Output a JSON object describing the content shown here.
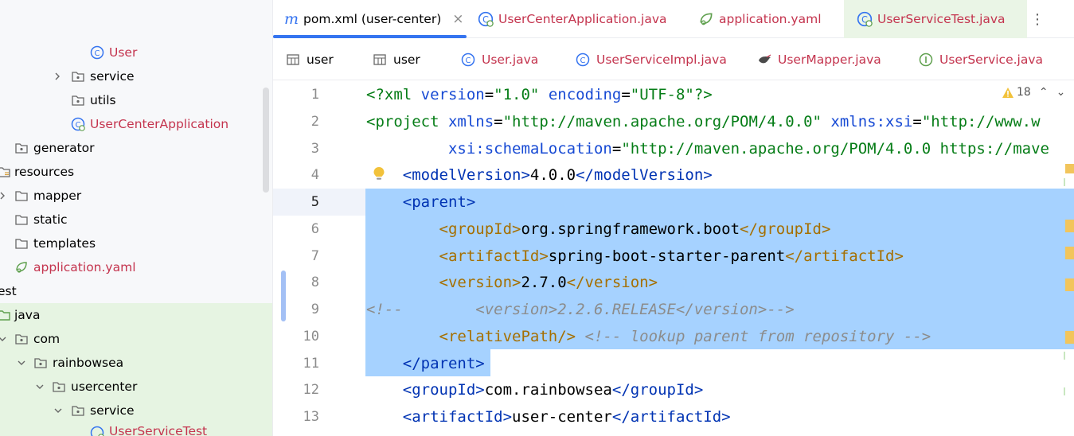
{
  "tree": {
    "items": [
      {
        "label": "User",
        "icon": "class-icon",
        "color": "red"
      },
      {
        "label": "service",
        "icon": "folder-icon",
        "chevron": "right"
      },
      {
        "label": "utils",
        "icon": "folder-icon"
      },
      {
        "label": "UserCenterApplication",
        "icon": "spring-class-icon",
        "color": "red"
      },
      {
        "label": "generator",
        "icon": "folder-icon"
      },
      {
        "label": "resources",
        "icon": "resources-folder-icon"
      },
      {
        "label": "mapper",
        "icon": "folder-icon",
        "chevron": "right"
      },
      {
        "label": "static",
        "icon": "folder-icon"
      },
      {
        "label": "templates",
        "icon": "folder-icon"
      },
      {
        "label": "application.yaml",
        "icon": "spring-leaf-icon",
        "color": "red"
      },
      {
        "label": "est",
        "icon": "none"
      },
      {
        "label": "java",
        "icon": "test-folder-icon"
      },
      {
        "label": "com",
        "icon": "folder-icon",
        "chevron": "down"
      },
      {
        "label": "rainbowsea",
        "icon": "folder-icon",
        "chevron": "down"
      },
      {
        "label": "usercenter",
        "icon": "folder-icon",
        "chevron": "down"
      },
      {
        "label": "service",
        "icon": "folder-icon",
        "chevron": "down"
      },
      {
        "label": "UserServiceTest",
        "icon": "spring-class-icon",
        "color": "red"
      }
    ]
  },
  "tabs": [
    {
      "label": "pom.xml (user-center)",
      "icon": "maven-icon",
      "active": true,
      "close": "×"
    },
    {
      "label": "UserCenterApplication.java",
      "icon": "spring-class-icon"
    },
    {
      "label": "application.yaml",
      "icon": "spring-leaf-icon"
    },
    {
      "label": "UserServiceTest.java",
      "icon": "spring-class-icon"
    }
  ],
  "more_tabs": "⋮",
  "tabs_row2": [
    {
      "label": "user",
      "icon": "table-icon",
      "color": "black"
    },
    {
      "label": "user",
      "icon": "table-icon",
      "color": "black"
    },
    {
      "label": "User.java",
      "icon": "class-icon",
      "color": "red"
    },
    {
      "label": "UserServiceImpl.java",
      "icon": "class-icon",
      "color": "red"
    },
    {
      "label": "UserMapper.java",
      "icon": "mybatis-bird-icon",
      "color": "red"
    },
    {
      "label": "UserService.java",
      "icon": "interface-icon",
      "color": "red"
    }
  ],
  "inspection": {
    "warnings": "18",
    "up": "⌃",
    "down": "⌄"
  },
  "editor": {
    "line_numbers": [
      "1",
      "2",
      "3",
      "4",
      "5",
      "6",
      "7",
      "8",
      "9",
      "10",
      "11",
      "12",
      "13"
    ],
    "current_line": "5",
    "lines": {
      "l1": {
        "a": "<?xml ",
        "b": "version",
        "c": "=",
        "d": "\"1.0\"",
        "e": " encoding",
        "f": "=",
        "g": "\"UTF-8\"",
        "h": "?>"
      },
      "l2": {
        "a": "<project ",
        "b": "xmlns",
        "c": "=",
        "d": "\"http://maven.apache.org/POM/4.0.0\"",
        "e": " xmlns:xsi",
        "f": "=",
        "g": "\"http://www.w"
      },
      "l3": {
        "a": "         xsi:schemaLocation",
        "b": "=",
        "c": "\"http://maven.apache.org/POM/4.0.0 https://mave"
      },
      "l4": {
        "a": "    <modelVersion>",
        "b": "4.0.0",
        "c": "</modelVersion>"
      },
      "l5": {
        "a": "    <parent>"
      },
      "l6": {
        "a": "        <groupId>",
        "b": "org.springframework.boot",
        "c": "</groupId>"
      },
      "l7": {
        "a": "        <artifactId>",
        "b": "spring-boot-starter-parent",
        "c": "</artifactId>"
      },
      "l8": {
        "a": "        <version>",
        "b": "2.7.0",
        "c": "</version>"
      },
      "l9": {
        "a": "<!--        <version>2.2.6.RELEASE</version>-->"
      },
      "l10": {
        "a": "        <relativePath/>",
        "b": " <!-- lookup parent from repository -->"
      },
      "l11": {
        "a": "    </parent>"
      },
      "l12": {
        "a": "    <groupId>",
        "b": "com.rainbowsea",
        "c": "</groupId>"
      },
      "l13": {
        "a": "    <artifactId>",
        "b": "user-center",
        "c": "</artifactId>"
      }
    }
  },
  "colors": {
    "accent": "#3574f0",
    "selection": "#a6d2ff",
    "warning": "#f2c55c",
    "test_green": "#e6f4e2",
    "modified_red": "#c4344e"
  }
}
